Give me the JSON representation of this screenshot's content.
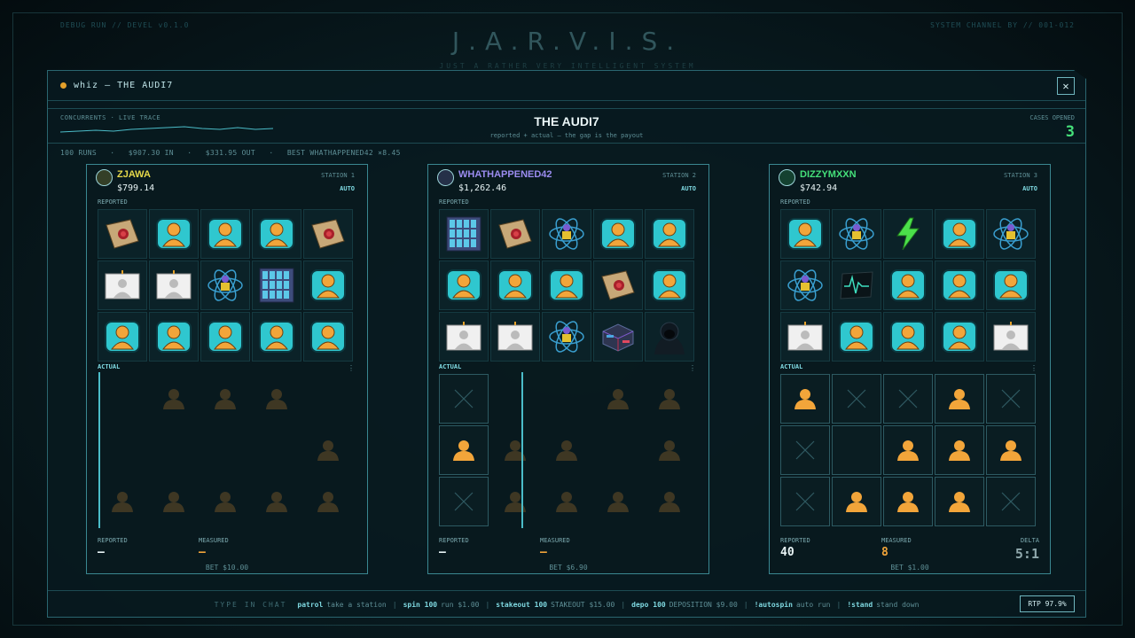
{
  "backdrop": {
    "title": "J.A.R.V.I.S.",
    "subtitle": "JUST A RATHER VERY INTELLIGENT SYSTEM",
    "corner_left": "DEBUG RUN // DEVEL v0.1.0",
    "corner_right": "SYSTEM CHANNEL BY // 001-012"
  },
  "window": {
    "title": "whiz — THE AUDI7",
    "close": "✕"
  },
  "header": {
    "concurrents_label": "CONCURRENTS · LIVE TRACE",
    "title": "THE AUDI7",
    "subtitle": "reported + actual — the gap is the payout",
    "cases_label": "CASES OPENED",
    "cases_value": "3"
  },
  "stats": {
    "text": "100 RUNS   ·   $907.30 IN   ·   $331.95 OUT   ·   BEST WHATHAPPENED42 ×8.45"
  },
  "stations": [
    {
      "player": "ZJAWA",
      "name_color": "#e6d84a",
      "balance": "$799.14",
      "station_label": "STATION 1",
      "mode": "AUTO",
      "reported_label": "REPORTED",
      "actual_label": "ACTUAL",
      "reported": [
        "dossier",
        "bust",
        "bust",
        "bust",
        "dossier",
        "idcard",
        "idcard",
        "atom",
        "servers",
        "bust",
        "bust",
        "bust",
        "bust",
        "bust",
        "bust"
      ],
      "actual": [
        "blank",
        "ghost",
        "ghost",
        "ghost",
        "blank",
        "blank",
        "blank",
        "blank",
        "blank",
        "ghost",
        "ghost",
        "ghost",
        "ghost",
        "ghost",
        "ghost"
      ],
      "actual_boxed": [
        false,
        false,
        false,
        false,
        false,
        false,
        false,
        false,
        false,
        false,
        false,
        false,
        false,
        false,
        false
      ],
      "footer": {
        "reported_label": "REPORTED",
        "reported_value": "—",
        "measured_label": "MEASURED",
        "measured_value": "—"
      },
      "bet": "BET $10.00"
    },
    {
      "player": "WHATHAPPENED42",
      "name_color": "#9b8cf0",
      "balance": "$1,262.46",
      "station_label": "STATION 2",
      "mode": "AUTO",
      "reported_label": "REPORTED",
      "actual_label": "ACTUAL",
      "reported": [
        "servers",
        "dossier",
        "atom",
        "bust",
        "bust",
        "bust",
        "bust",
        "bust",
        "dossier",
        "bust",
        "idcard",
        "idcard",
        "atom",
        "cubes",
        "hacker"
      ],
      "actual": [
        "x",
        "blank",
        "blank",
        "ghost",
        "ghost",
        "orange",
        "ghost",
        "ghost",
        "blank",
        "ghost",
        "x",
        "ghost",
        "ghost",
        "ghost",
        "ghost"
      ],
      "actual_boxed": [
        true,
        false,
        false,
        false,
        false,
        true,
        false,
        false,
        false,
        false,
        true,
        false,
        false,
        false,
        false
      ],
      "footer": {
        "reported_label": "REPORTED",
        "reported_value": "—",
        "measured_label": "MEASURED",
        "measured_value": "—"
      },
      "bet": "BET $6.90"
    },
    {
      "player": "DIZZYMXXN",
      "name_color": "#45e07a",
      "balance": "$742.94",
      "station_label": "STATION 3",
      "mode": "AUTO",
      "reported_label": "REPORTED",
      "actual_label": "ACTUAL",
      "reported": [
        "bust",
        "atom",
        "bolt",
        "bust",
        "atom",
        "atom",
        "monitor",
        "bust",
        "bust",
        "bust",
        "idcard",
        "bust",
        "bust",
        "bust",
        "idcard"
      ],
      "actual": [
        "orange",
        "x",
        "x",
        "orange",
        "x",
        "x",
        "empty",
        "orange",
        "orange",
        "orange",
        "x",
        "orange",
        "orange",
        "orange",
        "x"
      ],
      "actual_boxed": [
        true,
        true,
        true,
        true,
        true,
        true,
        true,
        true,
        true,
        true,
        true,
        true,
        true,
        true,
        true
      ],
      "footer": {
        "reported_label": "REPORTED",
        "reported_value": "40",
        "measured_label": "MEASURED",
        "measured_value": "8",
        "delta_label": "DELTA",
        "delta_value": "5:1"
      },
      "bet": "BET $1.00"
    }
  ],
  "footer": {
    "hint": "TYPE IN CHAT",
    "commands": [
      {
        "cmd": "patrol",
        "desc": "take a station"
      },
      {
        "cmd": "spin 100",
        "desc": "run $1.00"
      },
      {
        "cmd": "stakeout 100",
        "desc": "STAKEOUT $15.00"
      },
      {
        "cmd": "depo 100",
        "desc": "DEPOSITION $9.00"
      },
      {
        "cmd": "!autospin",
        "desc": "auto run"
      },
      {
        "cmd": "!stand",
        "desc": "stand down"
      }
    ],
    "rtp": "RTP 97.9%"
  },
  "colors": {
    "accent": "#7ed8e0",
    "bust_bg": "#2fc7cf",
    "orange": "#f2a53a",
    "green": "#45e07a"
  }
}
